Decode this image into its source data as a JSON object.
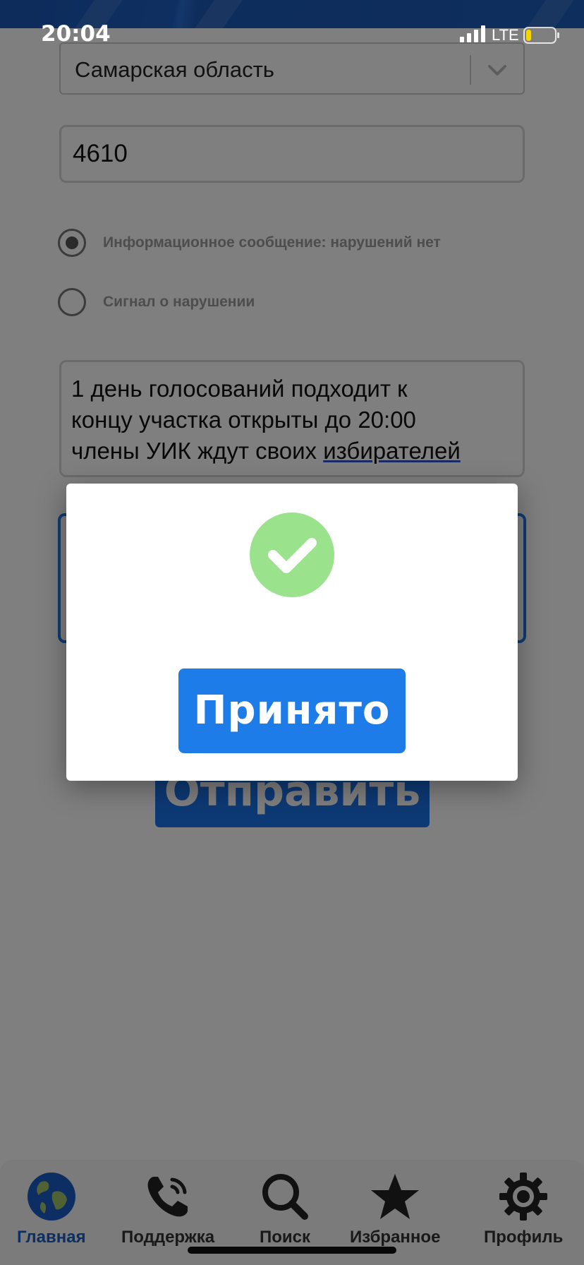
{
  "status_bar": {
    "time": "20:04",
    "network": "LTE"
  },
  "form": {
    "region_select": {
      "value": "Самарская область"
    },
    "number_input": {
      "value": "4610"
    },
    "radios": [
      {
        "label": "Информационное сообщение: нарушений нет",
        "checked": true
      },
      {
        "label": "Сигнал о нарушении",
        "checked": false
      }
    ],
    "message": {
      "line1": "1 день голосований подходит к",
      "line2": "концу участка открыты до 20:00",
      "line3_prefix": "члены УИК ждут своих ",
      "line3_misspelled": "избирателей"
    },
    "send_button": "Отправить"
  },
  "modal": {
    "icon": "success-check-icon",
    "accept_button": "Принято"
  },
  "bottom_nav": {
    "items": [
      {
        "label": "Главная",
        "icon": "globe-icon",
        "active": true
      },
      {
        "label": "Поддержка",
        "icon": "phone-icon",
        "active": false
      },
      {
        "label": "Поиск",
        "icon": "search-icon",
        "active": false
      },
      {
        "label": "Избранное",
        "icon": "star-icon",
        "active": false
      },
      {
        "label": "Профиль",
        "icon": "gear-icon",
        "active": false
      }
    ]
  },
  "colors": {
    "primary": "#1a73e8",
    "success": "#9be28d",
    "active_nav": "#1a5cc4"
  }
}
